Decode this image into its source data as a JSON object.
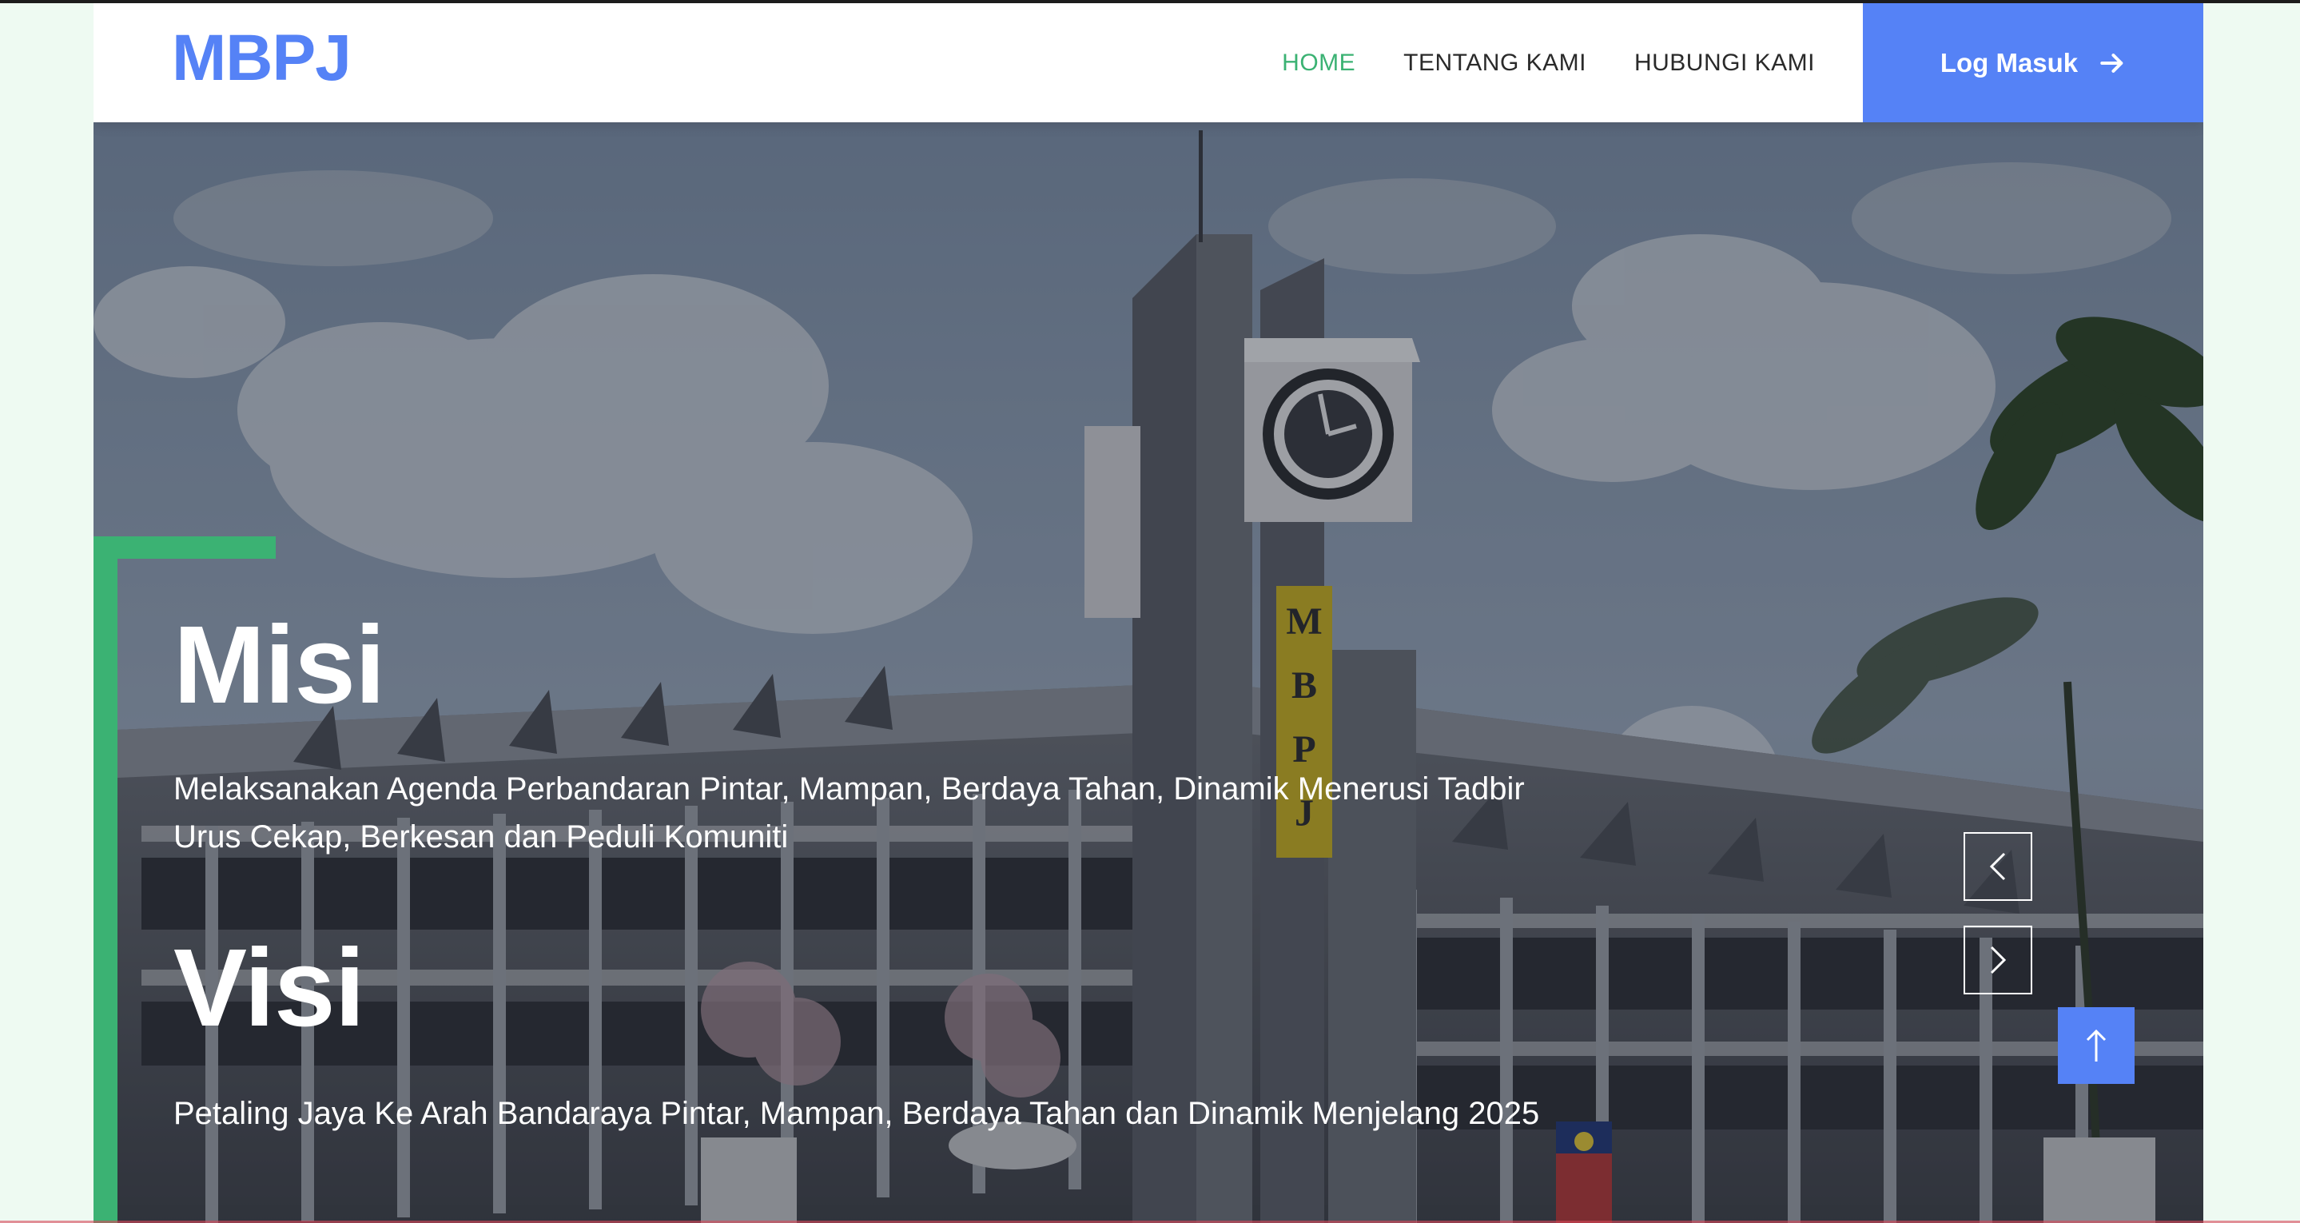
{
  "brand": {
    "logo_text": "MBPJ",
    "primary_color": "#5582f6",
    "accent_green": "#3bb273",
    "active_nav_color": "#3bb273"
  },
  "nav": {
    "items": [
      {
        "label": "HOME",
        "active": true
      },
      {
        "label": "TENTANG KAMI",
        "active": false
      },
      {
        "label": "HUBUNGI KAMI",
        "active": false
      }
    ],
    "login_label": "Log Masuk",
    "login_icon": "arrow-right-icon"
  },
  "hero": {
    "background": "photo of MBPJ building with clock tower under cloudy sky",
    "misi": {
      "heading": "Misi",
      "text": "Melaksanakan Agenda Perbandaran Pintar, Mampan, Berdaya Tahan, Dinamik Menerusi Tadbir Urus Cekap, Berkesan dan Peduli Komuniti"
    },
    "visi": {
      "heading": "Visi",
      "text": "Petaling Jaya Ke Arah Bandaraya Pintar, Mampan, Berdaya Tahan dan Dinamik Menjelang 2025"
    },
    "slider": {
      "prev_icon": "chevron-left-icon",
      "next_icon": "chevron-right-icon"
    }
  },
  "back_to_top": {
    "icon": "arrow-up-icon"
  }
}
